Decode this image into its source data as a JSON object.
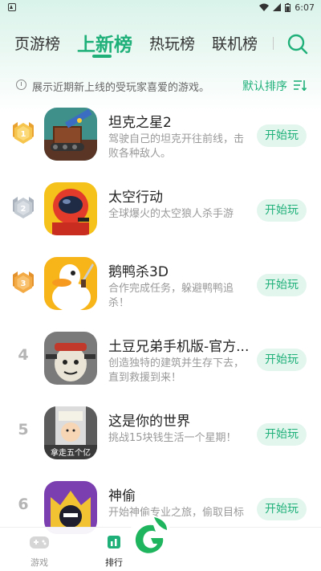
{
  "status_bar": {
    "time": "6:07"
  },
  "tabs": [
    {
      "label": "页游榜"
    },
    {
      "label": "上新榜"
    },
    {
      "label": "热玩榜"
    },
    {
      "label": "联机榜"
    }
  ],
  "info": {
    "text": "展示近期新上线的受玩家喜爱的游戏。",
    "sort_label": "默认排序"
  },
  "games": [
    {
      "rank": "1",
      "title": "坦克之星2",
      "desc": "驾驶自己的坦克开往前线，击败各种敌人。",
      "button": "开始玩"
    },
    {
      "rank": "2",
      "title": "太空行动",
      "desc": "全球爆火的太空狼人杀手游",
      "button": "开始玩"
    },
    {
      "rank": "3",
      "title": "鹅鸭杀3D",
      "desc": "合作完成任务，躲避鸭鸭追杀！",
      "button": "开始玩"
    },
    {
      "rank": "4",
      "title": "土豆兄弟手机版-官方...",
      "desc": "创造独特的建筑并生存下去，直到救援到来！",
      "button": "开始玩"
    },
    {
      "rank": "5",
      "title": "这是你的世界",
      "desc": "挑战15块钱生活一个星期！",
      "button": "开始玩",
      "icon_text": "拿走五个亿"
    },
    {
      "rank": "6",
      "title": "神偷",
      "desc": "开始神偷专业之旅，偷取目标",
      "button": "开始玩"
    }
  ],
  "bottom_nav": [
    {
      "label": "游戏"
    },
    {
      "label": "排行"
    }
  ],
  "colors": {
    "accent": "#1fb07a",
    "button_bg": "#e3f6ee",
    "gold": "#f2b640",
    "silver": "#b9c2cc",
    "bronze": "#f0a640"
  }
}
